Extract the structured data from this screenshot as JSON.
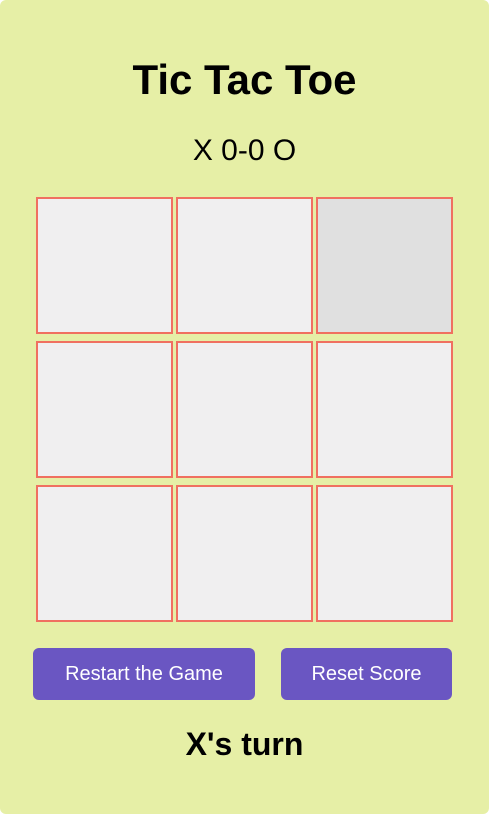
{
  "game": {
    "title": "Tic Tac Toe",
    "score": {
      "display": "X 0-0 O",
      "x": 0,
      "o": 0
    },
    "board": [
      "",
      "",
      "",
      "",
      "",
      "",
      "",
      "",
      ""
    ],
    "hovered_cell": 2,
    "buttons": {
      "restart_label": "Restart the Game",
      "reset_label": "Reset Score"
    },
    "status": "X's turn"
  },
  "colors": {
    "background": "#e6efa6",
    "cell_background": "#f0eff0",
    "cell_hover_background": "#e0e0e0",
    "cell_border": "#f07060",
    "button": "#6a56c2",
    "button_text": "#ffffff",
    "text": "#000000"
  }
}
